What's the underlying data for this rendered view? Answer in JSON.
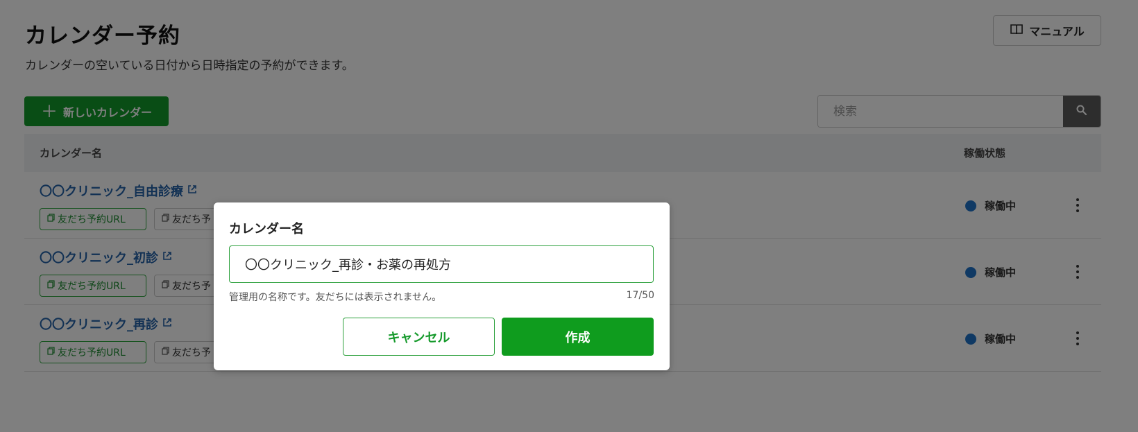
{
  "header": {
    "title": "カレンダー予約",
    "description": "カレンダーの空いている日付から日時指定の予約ができます。",
    "manual_label": "マニュアル"
  },
  "toolbar": {
    "new_calendar_label": "新しいカレンダー",
    "search_placeholder": "検索"
  },
  "table": {
    "columns": {
      "name": "カレンダー名",
      "status": "稼働状態"
    },
    "rows": [
      {
        "name": "〇〇クリニック_自由診療",
        "url_tag": "友だち予約URL",
        "other_tag": "友だち予",
        "status": "稼働中"
      },
      {
        "name": "〇〇クリニック_初診",
        "url_tag": "友だち予約URL",
        "other_tag": "友だち予",
        "status": "稼働中"
      },
      {
        "name": "〇〇クリニック_再診",
        "url_tag": "友だち予約URL",
        "other_tag": "友だち予",
        "status": "稼働中"
      }
    ]
  },
  "modal": {
    "label": "カレンダー名",
    "input_value": "〇〇クリニック_再診・お薬の再処方",
    "hint": "管理用の名称です。友だちには表示されません。",
    "counter": "17/50",
    "cancel_label": "キャンセル",
    "create_label": "作成"
  },
  "colors": {
    "accent_green": "#129a2a",
    "link_blue": "#2462a9",
    "status_blue": "#1f73c8",
    "overlay": "rgba(0,0,0,0.5)"
  },
  "icons": {
    "manual": "book-icon",
    "new": "plus-icon",
    "search": "magnifier-icon",
    "external": "external-link-icon",
    "copy": "copy-icon",
    "menu": "kebab-icon"
  }
}
